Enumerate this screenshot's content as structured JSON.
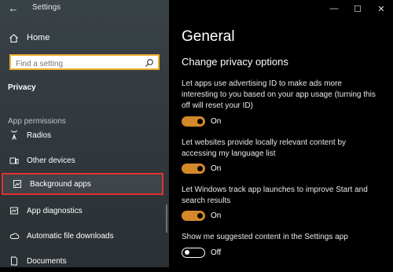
{
  "window": {
    "title": "Settings",
    "minimize_icon": "minimize-icon",
    "maximize_icon": "maximize-icon",
    "close_icon": "close-icon"
  },
  "sidebar": {
    "home_label": "Home",
    "search_placeholder": "Find a setting",
    "section_title": "Privacy",
    "group_header": "App permissions",
    "items": [
      {
        "label": "Radios",
        "icon": "radio-icon"
      },
      {
        "label": "Other devices",
        "icon": "devices-icon"
      },
      {
        "label": "Background apps",
        "icon": "background-apps-icon",
        "selected": true
      },
      {
        "label": "App diagnostics",
        "icon": "diagnostics-icon"
      },
      {
        "label": "Automatic file downloads",
        "icon": "cloud-icon"
      },
      {
        "label": "Documents",
        "icon": "document-icon"
      }
    ]
  },
  "main": {
    "title": "General",
    "subtitle": "Change privacy options",
    "options": [
      {
        "description": "Let apps use advertising ID to make ads more interesting to you based on your app usage (turning this off will reset your ID)",
        "state": "On",
        "on": true
      },
      {
        "description": "Let websites provide locally relevant content by accessing my language list",
        "state": "On",
        "on": true
      },
      {
        "description": "Let Windows track app launches to improve Start and search results",
        "state": "On",
        "on": true
      },
      {
        "description": "Show me suggested content in the Settings app",
        "state": "Off",
        "on": false
      }
    ]
  },
  "colors": {
    "accent": "#d4882a",
    "selection_border": "#e03131",
    "search_border": "#f0b132"
  }
}
